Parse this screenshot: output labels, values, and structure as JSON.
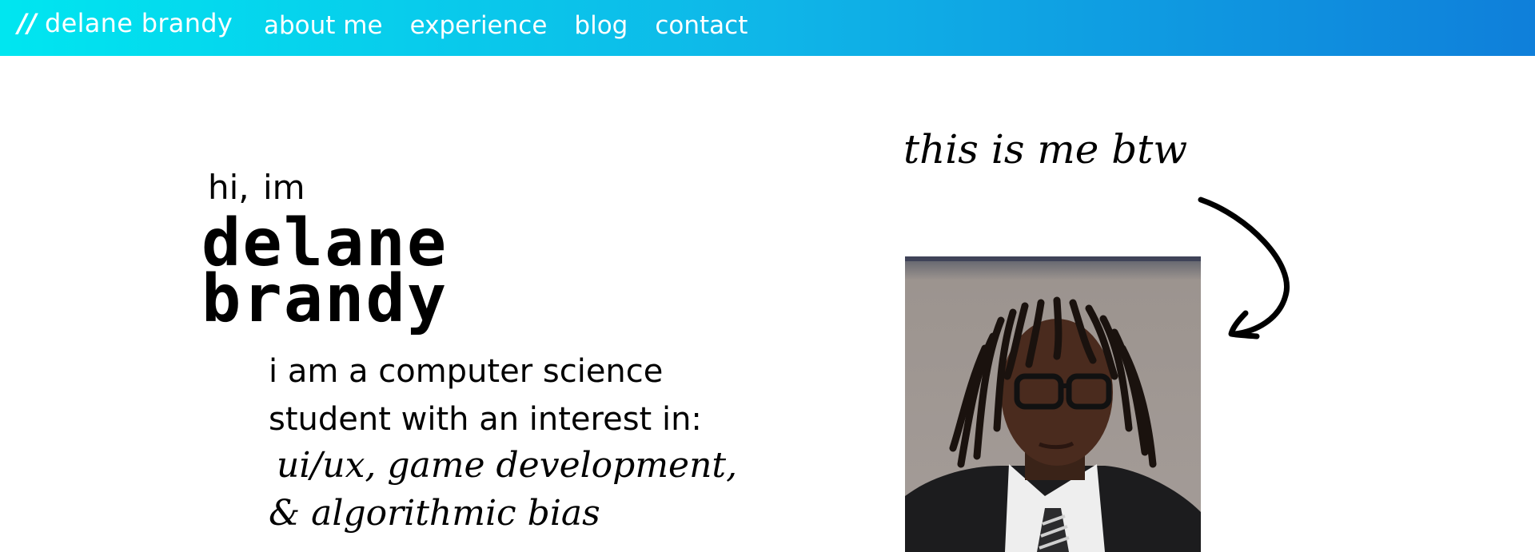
{
  "nav": {
    "brand_slashes": "//",
    "brand_name": "delane brandy",
    "links": [
      "about me",
      "experience",
      "blog",
      "contact"
    ]
  },
  "hero": {
    "greeting": "hi, im",
    "name_line1": "delane",
    "name_line2": "brandy",
    "intro_line1": "i am a computer science",
    "intro_line2": "student with an interest in:",
    "interests_line1": "ui/ux, game development,",
    "interests_line2": "& algorithmic bias"
  },
  "photo": {
    "caption": "this is me btw"
  },
  "colors": {
    "nav_gradient_start": "#00e6f0",
    "nav_gradient_end": "#0f7fda",
    "text": "#000000",
    "background": "#ffffff"
  },
  "icons": {
    "arrow": "curved-arrow-icon"
  }
}
